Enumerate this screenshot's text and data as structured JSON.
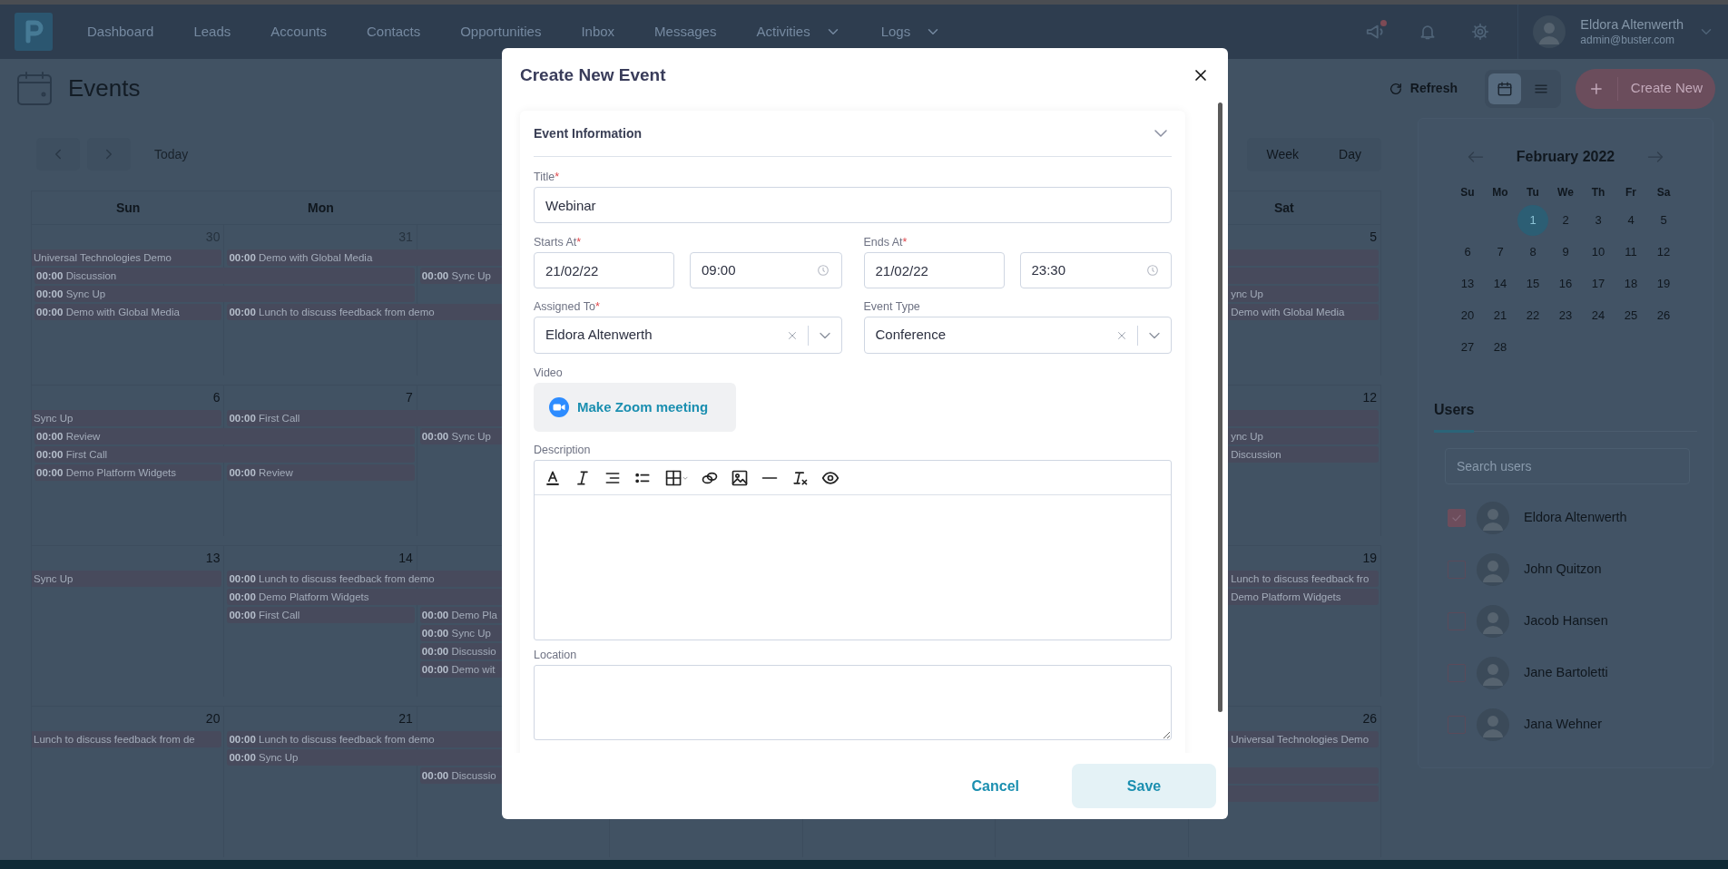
{
  "navbar": {
    "items": [
      {
        "label": "Dashboard",
        "dropdown": false
      },
      {
        "label": "Leads",
        "dropdown": false
      },
      {
        "label": "Accounts",
        "dropdown": false
      },
      {
        "label": "Contacts",
        "dropdown": false
      },
      {
        "label": "Opportunities",
        "dropdown": false
      },
      {
        "label": "Inbox",
        "dropdown": false
      },
      {
        "label": "Messages",
        "dropdown": false
      },
      {
        "label": "Activities",
        "dropdown": true
      },
      {
        "label": "Logs",
        "dropdown": true
      }
    ],
    "unread": true,
    "user": {
      "name": "Eldora Altenwerth",
      "email": "admin@buster.com"
    }
  },
  "page": {
    "title": "Events",
    "refresh": "Refresh",
    "view_modes": [
      {
        "kind": "calendar",
        "selected": true
      },
      {
        "kind": "list",
        "selected": false
      }
    ],
    "create_button": "Create New"
  },
  "calendar": {
    "today": "Today",
    "views": [
      {
        "label": "Week",
        "selected": false
      },
      {
        "label": "Day",
        "selected": false
      }
    ],
    "weekdays": {
      "sun": "Sun",
      "mon": "Mon",
      "sat": "Sat"
    },
    "weeks": [
      {
        "days": {
          "sun": {
            "number": "30",
            "outside_month": true
          },
          "mon": {
            "number": "31",
            "outside_month": true
          },
          "sat": {
            "number": "5",
            "outside_month": false
          }
        },
        "lanes": [
          {
            "sun": {
              "title": "Universal Technologies Demo",
              "continued": true,
              "spans_next_day": false
            },
            "mon": {
              "time": "00:00",
              "title": "Demo with Global Media",
              "continued": false,
              "spans_next_day": true
            },
            "fri": {
              "continued": false,
              "spans_next_day": true
            }
          },
          {
            "sun": {
              "time": "00:00",
              "title": "Discussion",
              "continued": false,
              "spans_next_day": true
            },
            "tue": {
              "time": "00:00",
              "title": "Sync Up",
              "continued": false,
              "spans_next_day": true
            },
            "fri": {
              "continued": false,
              "spans_next_day": true
            }
          },
          {
            "sun": {
              "time": "00:00",
              "title": "Sync Up",
              "continued": false,
              "spans_next_day": true
            },
            "fri": {
              "title": "ync Up",
              "continued": false,
              "spans_next_day": true
            }
          },
          {
            "sun": {
              "time": "00:00",
              "title": "Demo with Global Media",
              "continued": false,
              "spans_next_day": false
            },
            "mon": {
              "time": "00:00",
              "title": "Lunch to discuss feedback from demo",
              "continued": false,
              "spans_next_day": true
            },
            "fri": {
              "title": "Demo with Global Media",
              "continued": false,
              "spans_next_day": true
            }
          }
        ]
      },
      {
        "days": {
          "sun": {
            "number": "6",
            "outside_month": false
          },
          "mon": {
            "number": "7",
            "outside_month": false
          },
          "sat": {
            "number": "12",
            "outside_month": false
          }
        },
        "lanes": [
          {
            "sun": {
              "title": "Sync Up",
              "continued": true,
              "spans_next_day": false
            },
            "mon": {
              "time": "00:00",
              "title": "First Call",
              "continued": false,
              "spans_next_day": true
            },
            "fri": {
              "continued": false,
              "spans_next_day": true
            }
          },
          {
            "sun": {
              "time": "00:00",
              "title": "Review",
              "continued": false,
              "spans_next_day": true
            },
            "tue": {
              "time": "00:00",
              "title": "Sync Up",
              "continued": false,
              "spans_next_day": true
            },
            "fri": {
              "title": "ync Up",
              "continued": false,
              "spans_next_day": true
            }
          },
          {
            "sun": {
              "time": "00:00",
              "title": "First Call",
              "continued": false,
              "spans_next_day": true
            },
            "fri": {
              "title": "Discussion",
              "continued": false,
              "spans_next_day": true
            }
          },
          {
            "sun": {
              "time": "00:00",
              "title": "Demo Platform Widgets",
              "continued": false,
              "spans_next_day": false
            },
            "mon": {
              "time": "00:00",
              "title": "Review",
              "continued": false,
              "spans_next_day": false
            }
          }
        ]
      },
      {
        "days": {
          "sun": {
            "number": "13",
            "outside_month": false
          },
          "mon": {
            "number": "14",
            "outside_month": false
          },
          "sat": {
            "number": "19",
            "outside_month": false
          }
        },
        "lanes": [
          {
            "sun": {
              "title": "Sync Up",
              "continued": true,
              "spans_next_day": false
            },
            "mon": {
              "time": "00:00",
              "title": "Lunch to discuss feedback from demo",
              "continued": false,
              "spans_next_day": true
            },
            "fri": {
              "title": "Lunch to discuss feedback fro",
              "continued": false,
              "spans_next_day": true
            }
          },
          {
            "mon": {
              "time": "00:00",
              "title": "Demo Platform Widgets",
              "continued": false,
              "spans_next_day": true
            },
            "fri": {
              "title": "Demo Platform Widgets",
              "continued": false,
              "spans_next_day": true
            }
          },
          {
            "mon": {
              "time": "00:00",
              "title": "First Call",
              "continued": false,
              "spans_next_day": false
            },
            "tue": {
              "time": "00:00",
              "title": "Demo Pla",
              "continued": false,
              "spans_next_day": true
            }
          },
          {
            "tue": {
              "time": "00:00",
              "title": "Sync Up",
              "continued": false,
              "spans_next_day": true
            }
          },
          {
            "tue": {
              "time": "00:00",
              "title": "Discussio",
              "continued": false,
              "spans_next_day": true
            }
          },
          {
            "tue": {
              "time": "00:00",
              "title": "Demo wit",
              "continued": false,
              "spans_next_day": true
            }
          }
        ]
      },
      {
        "days": {
          "sun": {
            "number": "20",
            "outside_month": false
          },
          "mon": {
            "number": "21",
            "outside_month": false
          },
          "sat": {
            "number": "26",
            "outside_month": false
          }
        },
        "lanes": [
          {
            "sun": {
              "title": "Lunch to discuss feedback from de",
              "continued": true,
              "spans_next_day": false
            },
            "mon": {
              "time": "00:00",
              "title": "Lunch to discuss feedback from demo",
              "continued": false,
              "spans_next_day": true
            },
            "fri": {
              "title": "Universal Technologies Demo",
              "continued": false,
              "spans_next_day": true
            }
          },
          {
            "mon": {
              "time": "00:00",
              "title": "Sync Up",
              "continued": false,
              "spans_next_day": true
            }
          },
          {
            "tue": {
              "time": "00:00",
              "title": "Discussio",
              "continued": false,
              "spans_next_day": true
            },
            "fri": {
              "continued": false,
              "spans_next_day": true
            }
          },
          {
            "fri": {
              "continued": false,
              "spans_next_day": true
            }
          }
        ]
      }
    ]
  },
  "mini_calendar": {
    "title": "February 2022",
    "weekdays": [
      "Su",
      "Mo",
      "Tu",
      "We",
      "Th",
      "Fr",
      "Sa"
    ],
    "weeks": [
      {
        "tu": {
          "label": "1",
          "selected": true
        },
        "we": {
          "label": "2",
          "selected": false
        },
        "th": {
          "label": "3",
          "selected": false
        },
        "fr": {
          "label": "4",
          "selected": false
        },
        "sa": {
          "label": "5",
          "selected": false
        }
      },
      {
        "su": {
          "label": "6",
          "selected": false
        },
        "mo": {
          "label": "7",
          "selected": false
        },
        "tu": {
          "label": "8",
          "selected": false
        },
        "we": {
          "label": "9",
          "selected": false
        },
        "th": {
          "label": "10",
          "selected": false
        },
        "fr": {
          "label": "11",
          "selected": false
        },
        "sa": {
          "label": "12",
          "selected": false
        }
      },
      {
        "su": {
          "label": "13",
          "selected": false
        },
        "mo": {
          "label": "14",
          "selected": false
        },
        "tu": {
          "label": "15",
          "selected": false
        },
        "we": {
          "label": "16",
          "selected": false
        },
        "th": {
          "label": "17",
          "selected": false
        },
        "fr": {
          "label": "18",
          "selected": false
        },
        "sa": {
          "label": "19",
          "selected": false
        }
      },
      {
        "su": {
          "label": "20",
          "selected": false
        },
        "mo": {
          "label": "21",
          "selected": false
        },
        "tu": {
          "label": "22",
          "selected": false
        },
        "we": {
          "label": "23",
          "selected": false
        },
        "th": {
          "label": "24",
          "selected": false
        },
        "fr": {
          "label": "25",
          "selected": false
        },
        "sa": {
          "label": "26",
          "selected": false
        }
      },
      {
        "su": {
          "label": "27",
          "selected": false
        },
        "mo": {
          "label": "28",
          "selected": false
        }
      }
    ]
  },
  "users": {
    "tab": "Users",
    "search_placeholder": "Search users",
    "list": [
      {
        "name": "Eldora Altenwerth",
        "checked": true
      },
      {
        "name": "John Quitzon",
        "checked": false
      },
      {
        "name": "Jacob Hansen",
        "checked": false
      },
      {
        "name": "Jane Bartoletti",
        "checked": false
      },
      {
        "name": "Jana Wehner",
        "checked": false
      }
    ]
  },
  "modal": {
    "title": "Create New Event",
    "section": {
      "title": "Event Information",
      "expanded": true
    },
    "title_field": {
      "label": "Title",
      "required_mark": "*",
      "value": "Webinar"
    },
    "starts_at": {
      "label": "Starts At",
      "required_mark": "*",
      "date": "21/02/22",
      "time": "09:00"
    },
    "ends_at": {
      "label": "Ends At",
      "required_mark": "*",
      "date": "21/02/22",
      "time": "23:30"
    },
    "assigned_to": {
      "label": "Assigned To",
      "required_mark": "*",
      "value": "Eldora Altenwerth"
    },
    "event_type": {
      "label": "Event Type",
      "value": "Conference"
    },
    "video": {
      "label": "Video",
      "button": "Make Zoom meeting"
    },
    "description": {
      "label": "Description",
      "toolbar": [
        {
          "kind": "text-color"
        },
        {
          "kind": "italic"
        },
        {
          "kind": "align"
        },
        {
          "kind": "bullet-list"
        },
        {
          "kind": "table"
        },
        {
          "kind": "link"
        },
        {
          "kind": "image"
        },
        {
          "kind": "horizontal-rule"
        },
        {
          "kind": "clear-format"
        },
        {
          "kind": "preview"
        }
      ]
    },
    "location": {
      "label": "Location"
    },
    "cancel": "Cancel",
    "save": "Save"
  }
}
